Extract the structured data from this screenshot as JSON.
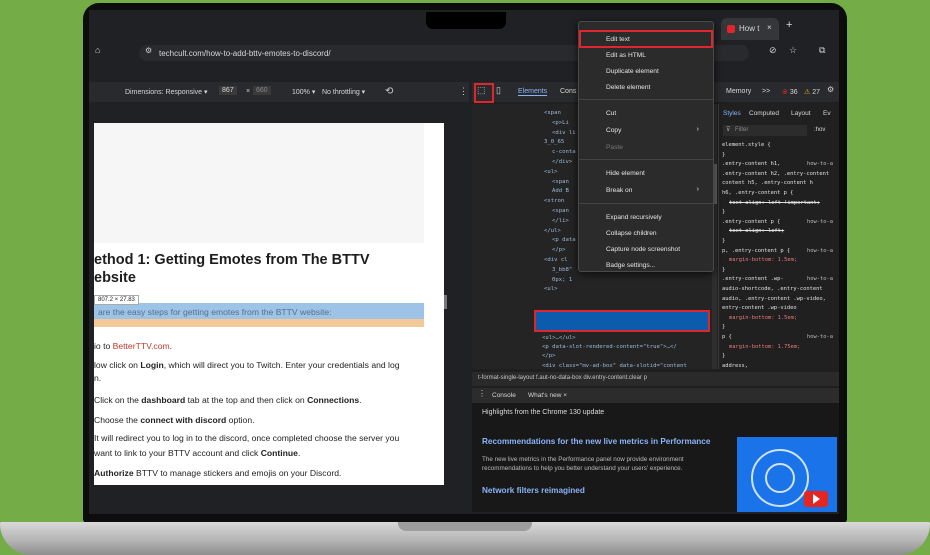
{
  "browser": {
    "tab_title": "How t",
    "new_tab_symbol": "+",
    "url": "techcult.com/how-to-add-bttv-emotes-to-discord/"
  },
  "device_toolbar": {
    "dimensions": "Dimensions: Responsive ▾",
    "width": "867",
    "x": "×",
    "height": "660",
    "zoom": "100% ▾",
    "throttle": "No throttling ▾"
  },
  "webpage": {
    "heading_line1": "ethod 1: Getting Emotes from The BTTV",
    "heading_line2": "ebsite",
    "tooltip": "807.2 × 27.83",
    "highlight": "are the easy steps for getting emotes from the BTTV website:",
    "step1_pre": "io to ",
    "step1_link": "BetterTTV.com",
    "step1_post": ".",
    "step2_pre": "low click on ",
    "step2_bold": "Login",
    "step2_post": ", which will direct you to Twitch. Enter your credentials and log",
    "step2_cont": "n.",
    "step3_pre": "Click on the ",
    "step3_bold": "dashboard",
    "step3_mid": " tab at the top and then click on ",
    "step3_bold2": "Connections",
    "step3_post": ".",
    "step4_pre": "Choose the ",
    "step4_bold": "connect with discord",
    "step4_post": " option.",
    "step5_line1": "It will redirect you to log in to the discord, once completed choose the server you",
    "step5_line2_pre": "want to link to your BTTV account and click ",
    "step5_bold": "Continue",
    "step5_post": ".",
    "step6_bold": "Authorize",
    "step6_post": " BTTV to manage stickers and emojis on your Discord."
  },
  "devtools": {
    "tabs": [
      "Elements",
      "Cons",
      "Memory",
      ">>"
    ],
    "errors": "36",
    "warnings": "27",
    "styles_tabs": [
      "Styles",
      "Computed",
      "Layout",
      "Ev"
    ],
    "filter_placeholder": "Filter",
    "hov": ":hov",
    "code_lines": [
      "<span",
      "<p>Li",
      "<div li",
      "3_0_65",
      "c-conta",
      "</div>",
      "<ul>",
      "<span",
      "Add B",
      "<stron",
      "<span",
      "</li>",
      "</ul>",
      "<p data",
      "</p>",
      "<div cl",
      "3_bb8\"",
      "0px; 1",
      "<ul>",
      "<p> Here are the easy steps for getting",
      "emotes from the BTTV website:</p> == $0",
      "<ul>…</ul>",
      "<p data-slot-rendered-content=\"true\">…</",
      "</p>",
      "<div class=\"mv-ad-box\" data-slotid=\"content",
      "t_3_bb8\" style=\"height: 380px; width: min",
      "(300px, 100%); 1380>…</div>"
    ],
    "styles_lines": [
      "element.style {",
      "}",
      ".entry-content h1,",
      ".entry-content h2, .entry-content",
      "content h5, .entry-content h",
      "h6, .entry-content p {",
      "text-align: left !important;",
      "}",
      ".entry-content p {",
      "text-align: left;",
      "}",
      "p, .entry-content p {",
      "margin-bottom: 1.5em;",
      "}",
      ".entry-content .wp-",
      "audio-shortcode, .entry-content",
      "audio, .entry-content .wp-video,",
      "entry-content .wp-video",
      "margin-bottom: 1.5em;",
      "}",
      "p {",
      "margin-bottom: 1.75em;",
      "}",
      "address,"
    ],
    "style_link": "how-to-a",
    "breadcrumb": "t-format-single-layout  f.aut-no-data-box  div.entry-content.clear  p",
    "drawer_tabs": [
      "Console",
      "What's new ×"
    ],
    "drawer_heading": "Highlights from the Chrome 130 update",
    "rec_title": "Recommendations for the new live metrics in Performance",
    "rec_body": "The new live metrics in the Performance panel now provide environment recommendations to help you better understand your users' experience.",
    "net_title": "Network filters reimagined"
  },
  "context_menu": {
    "items": [
      {
        "label": "Edit text",
        "submenu": false,
        "disabled": false
      },
      {
        "label": "Edit as HTML",
        "submenu": false,
        "disabled": false
      },
      {
        "label": "Duplicate element",
        "submenu": false,
        "disabled": false
      },
      {
        "label": "Delete element",
        "submenu": false,
        "disabled": false
      },
      {
        "label": "Cut",
        "submenu": false,
        "disabled": false
      },
      {
        "label": "Copy",
        "submenu": true,
        "disabled": false
      },
      {
        "label": "Paste",
        "submenu": false,
        "disabled": true
      },
      {
        "label": "Hide element",
        "submenu": false,
        "disabled": false
      },
      {
        "label": "Break on",
        "submenu": true,
        "disabled": false
      },
      {
        "label": "Expand recursively",
        "submenu": false,
        "disabled": false
      },
      {
        "label": "Collapse children",
        "submenu": false,
        "disabled": false
      },
      {
        "label": "Capture node screenshot",
        "submenu": false,
        "disabled": false
      },
      {
        "label": "Badge settings...",
        "submenu": false,
        "disabled": false
      }
    ]
  },
  "colors": {
    "background": "#74ac48",
    "highlight_red": "#e0262c",
    "devtools_link": "#8ab4f8"
  }
}
